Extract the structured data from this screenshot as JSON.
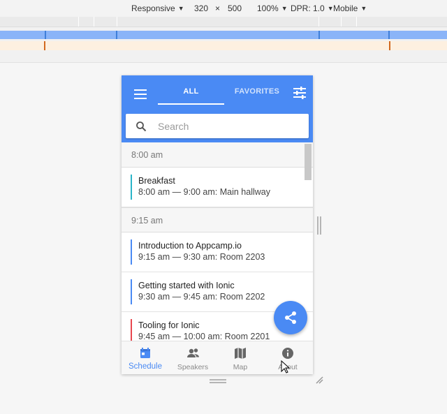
{
  "devtools": {
    "device": "Responsive",
    "width": "320",
    "times": "×",
    "height": "500",
    "zoom": "100%",
    "dpr": "DPR: 1.0",
    "mode": "Mobile"
  },
  "app": {
    "tabs": [
      {
        "label": "ALL",
        "active": true
      },
      {
        "label": "FAVORITES",
        "active": false
      }
    ],
    "search": {
      "placeholder": "Search",
      "value": ""
    },
    "colors": {
      "primary": "#4a8af4"
    },
    "schedule": [
      {
        "time": "8:00 am"
      },
      {
        "title": "Breakfast",
        "detail": "8:00 am — 9:00 am: Main hallway",
        "track_color": "#2bb5c9"
      },
      {
        "time": "9:15 am"
      },
      {
        "title": "Introduction to Appcamp.io",
        "detail": "9:15 am — 9:30 am: Room 2203",
        "track_color": "#4a8af4"
      },
      {
        "title": "Getting started with Ionic",
        "detail": "9:30 am — 9:45 am: Room 2202",
        "track_color": "#4a8af4"
      },
      {
        "title": "Tooling for Ionic",
        "detail": "9:45 am — 10:00 am: Room 2201",
        "track_color": "#e8474f"
      }
    ],
    "fab_icon": "share-icon",
    "tabbar": [
      {
        "label": "Schedule",
        "icon": "calendar-icon",
        "active": true
      },
      {
        "label": "Speakers",
        "icon": "contacts-icon",
        "active": false
      },
      {
        "label": "Map",
        "icon": "map-icon",
        "active": false
      },
      {
        "label": "About",
        "icon": "info-icon",
        "active": false
      }
    ]
  }
}
